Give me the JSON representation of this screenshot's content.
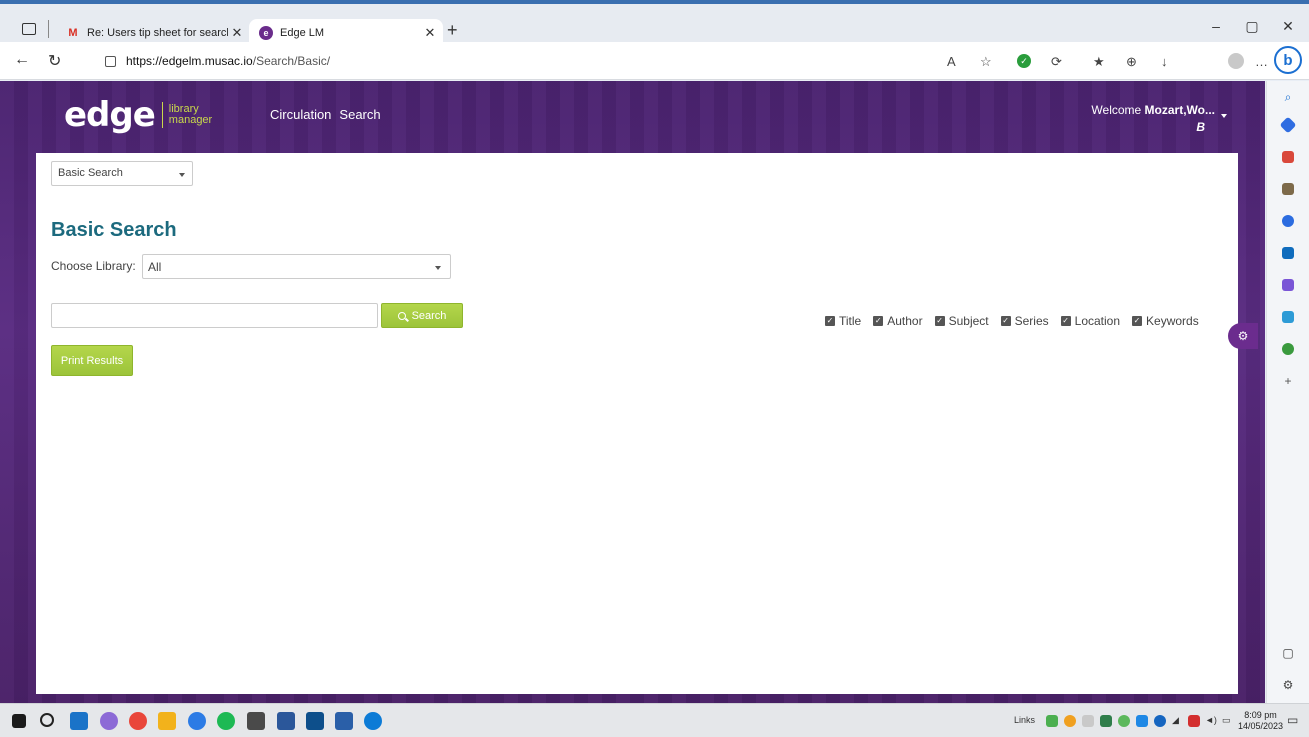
{
  "browser": {
    "tabs": [
      {
        "title": "Re: Users tip sheet for searching",
        "favicon": "gmail-icon"
      },
      {
        "title": "Edge LM",
        "favicon": "edge-lm-icon"
      }
    ],
    "url_host": "https://edgelm.musac.io",
    "url_path": "/Search/Basic/"
  },
  "site": {
    "logo_main": "edge",
    "logo_sub_1": "library",
    "logo_sub_2": "manager",
    "nav": [
      "Circulation",
      "Search"
    ],
    "welcome_prefix": "Welcome",
    "welcome_user": "Mozart,Wo...",
    "welcome_initial": "B"
  },
  "search": {
    "type_select": "Basic Search",
    "title": "Basic Search",
    "library_label": "Choose Library:",
    "library_value": "All",
    "query_value": "",
    "search_button": "Search",
    "print_button": "Print Results",
    "filters": [
      "Title",
      "Author",
      "Subject",
      "Series",
      "Location",
      "Keywords"
    ]
  },
  "taskbar": {
    "links_label": "Links",
    "time": "8:09 pm",
    "date": "14/05/2023"
  },
  "colors": {
    "purple": "#5a2c82",
    "accent_green": "#9cc43a",
    "heading_teal": "#1c6a7e"
  }
}
